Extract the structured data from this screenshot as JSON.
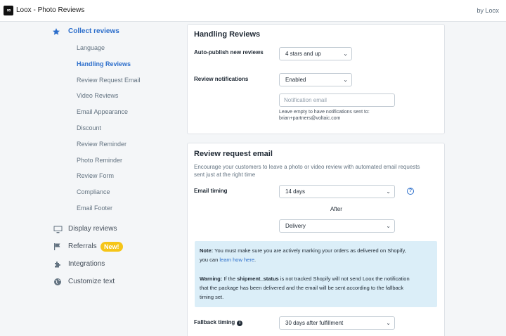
{
  "header": {
    "logo_text": "∞",
    "title": "Loox - Photo Reviews",
    "by": "by Loox"
  },
  "sidebar": {
    "collect": "Collect reviews",
    "sub_items": [
      "Language",
      "Handling Reviews",
      "Review Request Email",
      "Video Reviews",
      "Email Appearance",
      "Discount",
      "Review Reminder",
      "Photo Reminder",
      "Review Form",
      "Compliance",
      "Email Footer"
    ],
    "display": "Display reviews",
    "referrals": "Referrals",
    "referrals_badge": "New!",
    "integrations": "Integrations",
    "customize": "Customize text"
  },
  "handling": {
    "title": "Handling Reviews",
    "auto_publish_label": "Auto-publish new reviews",
    "auto_publish_value": "4 stars and up",
    "notifications_label": "Review notifications",
    "notifications_value": "Enabled",
    "email_placeholder": "Notification email",
    "help_line1": "Leave empty to have notifications sent to:",
    "help_line2": "brian+partners@voltaic.com"
  },
  "request": {
    "title": "Review request email",
    "desc_line1": "Encourage your customers to leave a photo or video review with automated email requests",
    "desc_line2": "sent just at the right time",
    "timing_label": "Email timing",
    "timing_value": "14 days",
    "help_icon": "?",
    "after": "After",
    "event_value": "Delivery",
    "note_label": "Note:",
    "note_text": "You must make sure you are actively marking your orders as delivered on Shopify,",
    "note_text2": "you can",
    "note_link": "learn how here",
    "note_end": ".",
    "warning_label": "Warning:",
    "warning_text1": "If the",
    "warning_field": "shipment_status",
    "warning_text2": "is not tracked Shopify will not send Loox the notification",
    "warning_line2": "that the package has been delivered and the email will be sent according to the fallback",
    "warning_line3": "timing set.",
    "fallback_label": "Fallback timing",
    "fallback_value": "30 days after fulfillment"
  },
  "colors": {
    "accent": "#2c6ecb",
    "badge": "#f5c518",
    "note_bg": "#dbeef8"
  }
}
